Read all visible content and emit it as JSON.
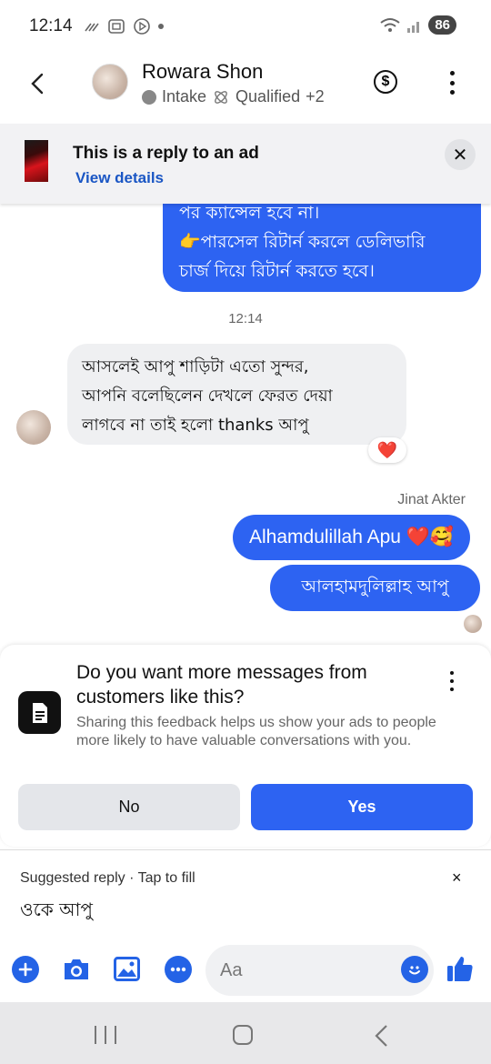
{
  "status_bar": {
    "time": "12:14",
    "battery": "86"
  },
  "header": {
    "contact_name": "Rowara Shon",
    "label_stage": "Intake",
    "label_tag": "Qualified",
    "label_more": "+2",
    "icons": {
      "back": "back-arrow-icon",
      "money": "dollar-icon",
      "menu": "more-vertical-icon"
    }
  },
  "ad_banner": {
    "title": "This is a reply to an ad",
    "link": "View details"
  },
  "messages": {
    "outgoing_top_lines": [
      "পর ক্যান্সেল হবে না।",
      "👉পারসেল রিটার্ন করলে ডেলিভারি",
      "চার্জ দিয়ে রিটার্ন করতে হবে।"
    ],
    "timestamp": "12:14",
    "incoming_lines": [
      "আসলেই আপু শাড়িটা এতো সুন্দর,",
      "আপনি বলেছিলেন দেখলে ফেরত দেয়া",
      "লাগবে না তাই হলো thanks আপু"
    ],
    "reaction": "❤️",
    "sender_name": "Jinat Akter",
    "outgoing_1": "Alhamdulillah Apu ❤️🥰",
    "outgoing_2": "আলহামদুলিল্লাহ আপু"
  },
  "feedback": {
    "title": "Do you want more messages from customers like this?",
    "description": "Sharing this feedback helps us show your ads to people more likely to have valuable conversations with you.",
    "no_label": "No",
    "yes_label": "Yes"
  },
  "suggested_reply": {
    "label": "Suggested reply · Tap to fill",
    "close": "×",
    "text": "ওকে আপু"
  },
  "composer": {
    "placeholder": "Aa"
  },
  "colors": {
    "accent": "#2d63f2",
    "incoming_bubble": "#eff0f2",
    "link": "#1a56c4"
  }
}
